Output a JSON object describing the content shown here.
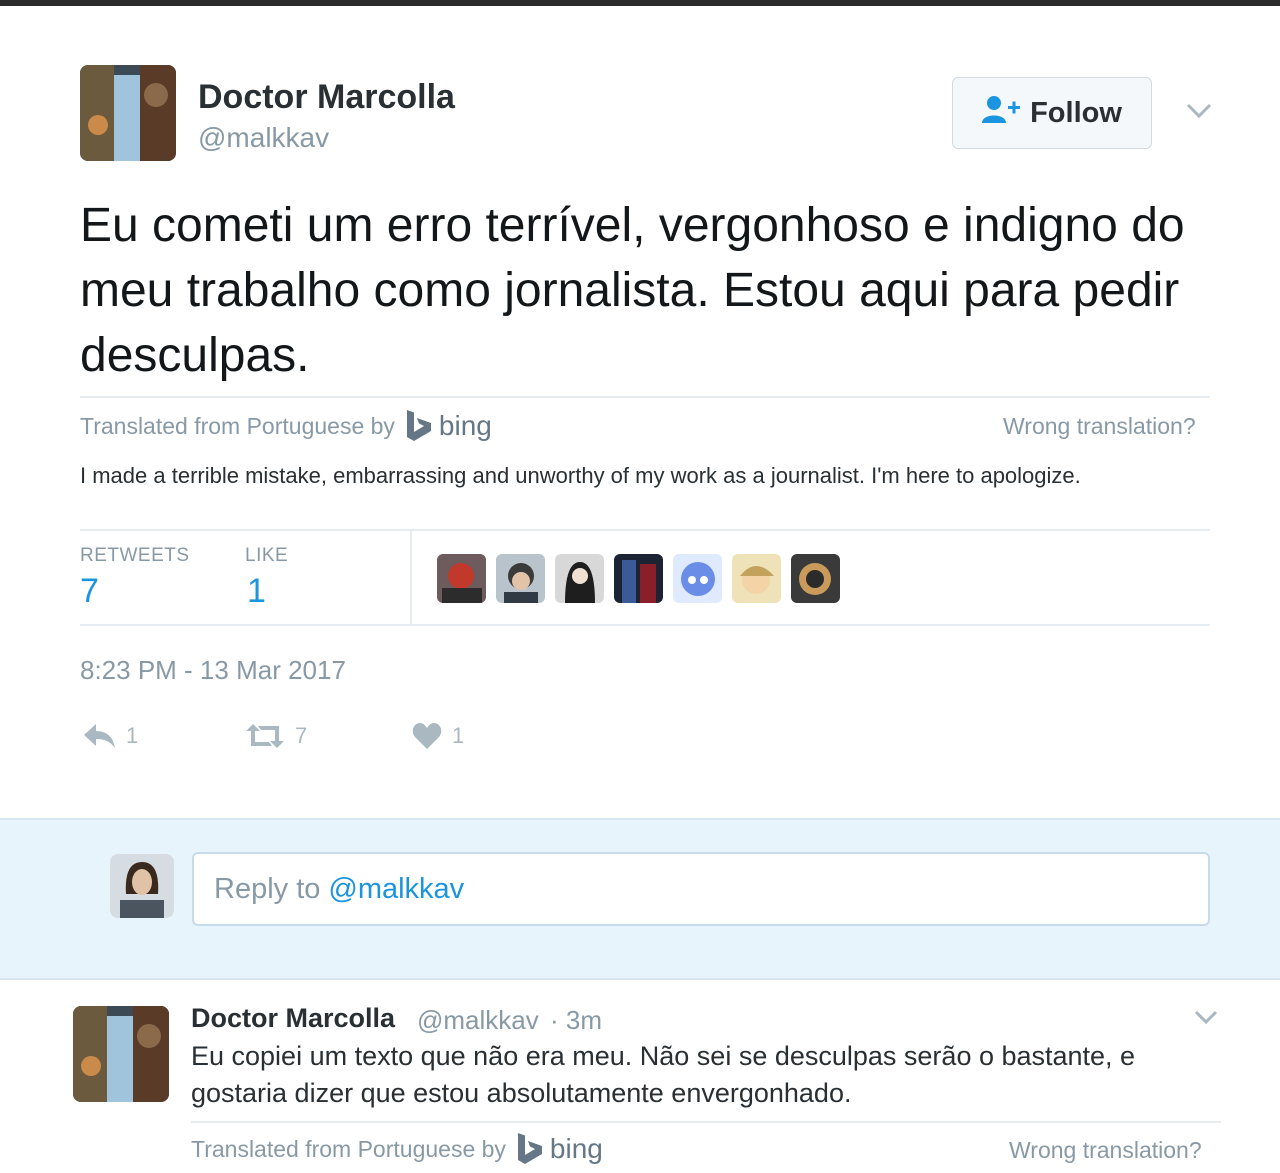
{
  "tweet": {
    "author_name": "Doctor Marcolla",
    "author_handle": "@malkkav",
    "follow_label": "Follow",
    "text": "Eu cometi um erro terrível, vergonhoso e indigno do meu trabalho como jornalista. Estou aqui para pedir desculpas.",
    "translated_from": "Translated from Portuguese by",
    "translator": "bing",
    "wrong_translation": "Wrong translation?",
    "translation": "I made a terrible mistake, embarrassing and unworthy of my work as a journalist. I'm here to apologize.",
    "stats": {
      "retweets_label": "RETWEETS",
      "retweets_value": "7",
      "likes_label": "LIKE",
      "likes_value": "1"
    },
    "liker_avatars": [
      "liker-avatar-1",
      "liker-avatar-2",
      "liker-avatar-3",
      "liker-avatar-4",
      "liker-avatar-5",
      "liker-avatar-6",
      "liker-avatar-7"
    ],
    "timestamp": "8:23 PM - 13 Mar 2017",
    "actions": {
      "reply_count": "1",
      "retweet_count": "7",
      "like_count": "1"
    }
  },
  "reply_box": {
    "placeholder_prefix": "Reply to",
    "placeholder_mention": "@malkkav"
  },
  "reply": {
    "author_name": "Doctor Marcolla",
    "author_handle": "@malkkav",
    "time": "· 3m",
    "text": "Eu copiei um texto que não era meu. Não sei se desculpas serão o bastante, e gostaria dizer que estou absolutamente envergonhado.",
    "translated_from": "Translated from Portuguese by",
    "translator": "bing",
    "wrong_translation": "Wrong translation?"
  },
  "colors": {
    "link_blue": "#1b95e0",
    "muted_gray": "#8899a6",
    "reply_bg": "#e8f4fb",
    "heart": "#aab8c2"
  }
}
